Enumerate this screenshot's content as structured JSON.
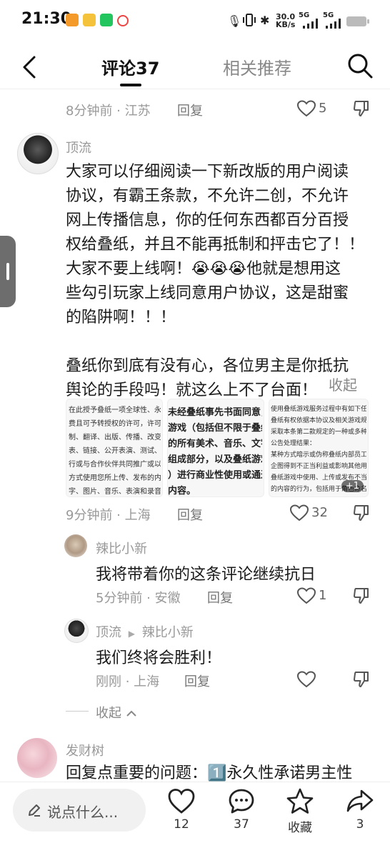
{
  "status_bar": {
    "time": "21:30",
    "net_speed_value": "30.0",
    "net_speed_unit": "KB/s",
    "signal_1": "5G",
    "signal_2": "5G"
  },
  "header": {
    "tab_comments": "评论37",
    "tab_related": "相关推荐"
  },
  "prev_comment": {
    "meta": "8分钟前 · 江苏",
    "reply": "回复",
    "likes": "5"
  },
  "main_comment": {
    "username": "顶流",
    "lines": [
      "大家可以仔细阅读一下新改版的用户阅读",
      "协议，有霸王条款，不允许二创，不允许",
      "网上传播信息，你的任何东西都百分百授",
      "权给叠纸，并且不能再抵制和抨击它了！！",
      "大家不要上线啊！😭😭😭他就是想用这",
      "些勾引玩家上线同意用户协议，这是甜蜜",
      "的陷阱啊！！！",
      "",
      "叠纸你到底有没有心，各位男主是你抵抗",
      "舆论的手段吗！就这么上不了台面！"
    ],
    "collapse": "收起",
    "meta": "9分钟前 · 上海",
    "reply": "回复",
    "likes": "32",
    "image_count": "+1",
    "thumb_texts": [
      [
        "在此授予叠纸一项全球性、永久的、",
        "费且可予转授权的许可，许可叠纸使",
        "制、翻译、出版、传播、改变、发布",
        "表、链接、公开表演、测试、公开传",
        "行或与合作伙伴共同推广或以其他适",
        "方式使用您所上传、发布的内容（包",
        "字、图片、音乐、表演和录音录像制"
      ],
      [
        "未经叠纸事先书面同意，您",
        "游戏（包括但不限于叠纸游",
        "的所有美术、音乐、文字作",
        "组成部分，以及叠纸游戏",
        "）进行商业性使用或通过",
        "内容。"
      ],
      [
        "使用叠纸游戏服务过程中有如下任何行",
        "叠纸有权依据本协议及相关游戏规则",
        "采取本条第二款规定的一种或多种处",
        "公告处理结果：",
        "某种方式暗示或伪称叠纸内部员工或某",
        "企图得到不正当利益或影响其他用户",
        "叠纸游戏中使用、上传或发布不当内",
        "的内容的行为，包括用于角色命名"
      ]
    ]
  },
  "replies": [
    {
      "username": "辣比小新",
      "text": "我将带着你的这条评论继续抗日",
      "meta": "5分钟前 · 安徽",
      "reply": "回复",
      "likes": "1"
    },
    {
      "username": "顶流",
      "reply_to": "辣比小新",
      "text": "我们终将会胜利！",
      "meta": "刚刚 · 上海",
      "reply": "回复",
      "likes": ""
    }
  ],
  "collapse_replies": "收起",
  "next_comment": {
    "username": "发财树",
    "text": "回复点重要的问题：1️⃣永久性承诺男主性"
  },
  "bottom_bar": {
    "input_placeholder": "说点什么...",
    "like_count": "12",
    "comment_count": "37",
    "collect_label": "收藏",
    "share_count": "3"
  },
  "colors": {
    "text_primary": "#1a1a1a",
    "text_meta": "#999999",
    "input_bg": "#f1f1f1"
  }
}
